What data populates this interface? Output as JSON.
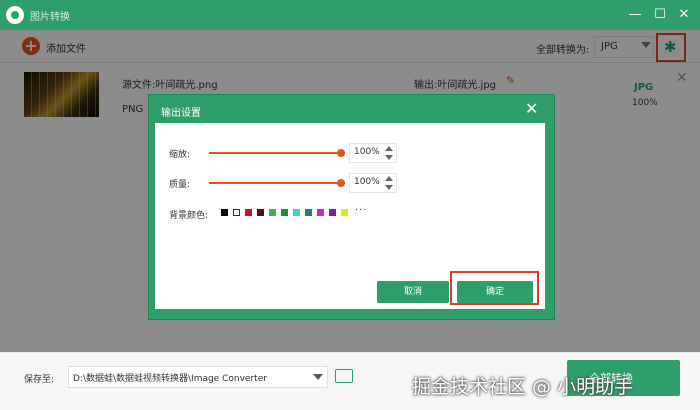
{
  "app": {
    "title": "图片转换"
  },
  "window_controls": {
    "minimize": "—",
    "maximize": "☐",
    "close": "✕"
  },
  "toolbar": {
    "add_icon": "+",
    "add_label": "添加文件",
    "convert_all_label": "全部转换为:",
    "format_value": "JPG",
    "settings_icon": "✱"
  },
  "file": {
    "source_label": "源文件:叶间疏光.png",
    "source_format": "PNG",
    "output_label": "输出:叶间疏光.jpg",
    "target_format": "JPG",
    "target_percent": "100%",
    "close_icon": "✕",
    "edit_icon": "✎"
  },
  "dialog": {
    "title": "输出设置",
    "close_icon": "✕",
    "scale_label": "缩放:",
    "scale_value": "100%",
    "scale_level": 1.0,
    "quality_label": "质量:",
    "quality_value": "100%",
    "quality_level": 1.0,
    "bg_label": "背景颜色:",
    "more": "···",
    "swatches": [
      "#000000",
      "#ffffff",
      "#c8102e",
      "#5a0f0f",
      "#3db34a",
      "#1e8a3a",
      "#3fd3c8",
      "#16866f",
      "#d21fc0",
      "#7a1ea8",
      "#d8e81a"
    ],
    "cancel_label": "取消",
    "ok_label": "确定"
  },
  "footer": {
    "save_to_label": "保存至:",
    "path": "D:\\数据蛙\\数据蛙视频转换器\\Image Converter",
    "convert_button": "全部转换"
  },
  "watermark": "掘金技术社区 @ 小明助手",
  "colors": {
    "accent": "#2e9e6b",
    "orange": "#e8541e",
    "highlight": "#e03c2d"
  }
}
